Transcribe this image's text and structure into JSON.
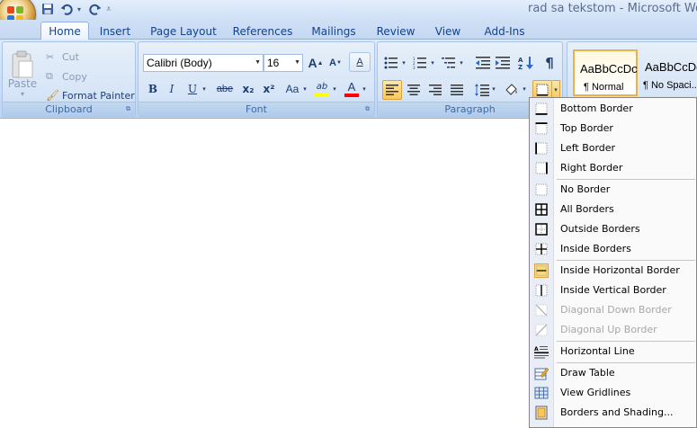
{
  "window": {
    "title": "rad sa tekstom - Microsoft Word"
  },
  "quick_access": {
    "items": [
      "save-icon",
      "undo-icon",
      "redo-icon",
      "customize-icon"
    ]
  },
  "tabs": [
    "Home",
    "Insert",
    "Page Layout",
    "References",
    "Mailings",
    "Review",
    "View",
    "Add-Ins"
  ],
  "active_tab": "Home",
  "clipboard": {
    "paste_label": "Paste",
    "cut_label": "Cut",
    "copy_label": "Copy",
    "format_painter_label": "Format Painter",
    "group_label": "Clipboard"
  },
  "font": {
    "font_name": "Calibri (Body)",
    "font_size": "16",
    "bold": "B",
    "italic": "I",
    "underline": "U",
    "strikethrough": "abe",
    "subscript": "x₂",
    "superscript": "x²",
    "change_case": "Aa",
    "grow": "A",
    "shrink": "A",
    "clear": "A",
    "highlight": "ab",
    "font_color": "A",
    "group_label": "Font"
  },
  "paragraph": {
    "show_marks": "¶",
    "group_label": "Paragraph"
  },
  "styles": {
    "items": [
      {
        "sample": "AaBbCcDc",
        "name": "¶ Normal"
      },
      {
        "sample": "AaBbCcDc",
        "name": "¶ No Spaci..."
      }
    ]
  },
  "borders_menu": {
    "items": [
      {
        "label": "Bottom Border",
        "icon": "bottom-border-icon",
        "disabled": false
      },
      {
        "label": "Top Border",
        "icon": "top-border-icon",
        "disabled": false
      },
      {
        "label": "Left Border",
        "icon": "left-border-icon",
        "disabled": false
      },
      {
        "label": "Right Border",
        "icon": "right-border-icon",
        "disabled": false
      },
      {
        "label": "No Border",
        "icon": "no-border-icon",
        "disabled": false
      },
      {
        "label": "All Borders",
        "icon": "all-borders-icon",
        "disabled": false
      },
      {
        "label": "Outside Borders",
        "icon": "outside-borders-icon",
        "disabled": false
      },
      {
        "label": "Inside Borders",
        "icon": "inside-borders-icon",
        "disabled": false
      },
      {
        "label": "Inside Horizontal Border",
        "icon": "inside-horizontal-border-icon",
        "disabled": false
      },
      {
        "label": "Inside Vertical Border",
        "icon": "inside-vertical-border-icon",
        "disabled": false
      },
      {
        "label": "Diagonal Down Border",
        "icon": "diagonal-down-border-icon",
        "disabled": true
      },
      {
        "label": "Diagonal Up Border",
        "icon": "diagonal-up-border-icon",
        "disabled": true
      },
      {
        "label": "Horizontal Line",
        "icon": "horizontal-line-icon",
        "disabled": false
      },
      {
        "label": "Draw Table",
        "icon": "draw-table-icon",
        "disabled": false
      },
      {
        "label": "View Gridlines",
        "icon": "view-gridlines-icon",
        "disabled": false
      },
      {
        "label": "Borders and Shading...",
        "icon": "borders-shading-icon",
        "disabled": false
      }
    ],
    "highlighted": "Inside Horizontal Border"
  },
  "colors": {
    "highlight_yellow": "#ffff00",
    "font_red": "#ff0000"
  }
}
